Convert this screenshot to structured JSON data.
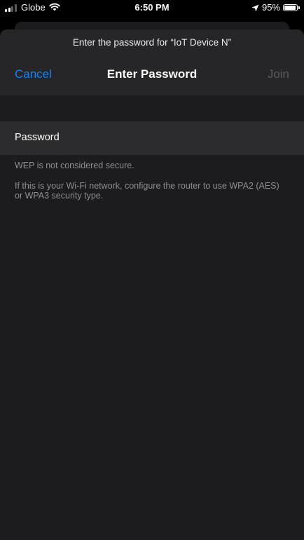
{
  "status_bar": {
    "carrier": "Globe",
    "time": "6:50 PM",
    "battery_percent": "95%",
    "battery_level": 0.95,
    "signal_bars_filled": 2,
    "signal_bars_total": 4,
    "icons": [
      "signal-icon",
      "wifi-icon",
      "location-arrow-icon",
      "battery-icon"
    ]
  },
  "sheet": {
    "prompt": "Enter the password for “IoT Device N”",
    "title": "Enter Password",
    "cancel_label": "Cancel",
    "join_label": "Join"
  },
  "form": {
    "password_label": "Password",
    "password_value": "",
    "password_placeholder": ""
  },
  "notes": {
    "security_warning": "WEP is not considered secure.",
    "recommendation": "If this is your Wi-Fi network, configure the router to use WPA2 (AES) or WPA3 security type."
  },
  "colors": {
    "accent": "#0a84ff",
    "disabled": "#5a5a5e",
    "sheet_background": "#1c1c1e",
    "row_background": "#2c2c2e",
    "secondary_text": "#8e8e93"
  }
}
